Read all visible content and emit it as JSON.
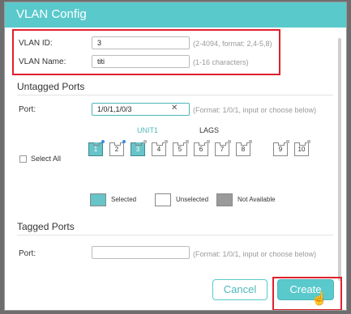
{
  "dialog": {
    "title": "VLAN Config"
  },
  "vlan_id": {
    "label": "VLAN ID:",
    "value": "3",
    "hint": "(2-4094, format: 2,4-5,8)"
  },
  "vlan_name": {
    "label": "VLAN Name:",
    "value": "titi",
    "hint": "(1-16 characters)"
  },
  "untagged": {
    "title": "Untagged Ports",
    "port_label": "Port:",
    "port_value": "1/0/1,1/0/3",
    "port_hint": "(Format: 1/0/1, input or choose below)",
    "unit_tab": "UNIT1",
    "lags_tab": "LAGS",
    "select_all": "Select All",
    "ports": [
      {
        "label": "1",
        "state": "selected"
      },
      {
        "label": "2",
        "state": "unselected"
      },
      {
        "label": "3",
        "state": "selected"
      },
      {
        "label": "4",
        "state": "unselected"
      },
      {
        "label": "5",
        "state": "unselected"
      },
      {
        "label": "6",
        "state": "unselected"
      },
      {
        "label": "7",
        "state": "unselected"
      },
      {
        "label": "8",
        "state": "unselected"
      }
    ],
    "lags": [
      {
        "label": "9",
        "state": "unselected"
      },
      {
        "label": "10",
        "state": "unselected"
      }
    ]
  },
  "legend": {
    "selected": "Selected",
    "unselected": "Unselected",
    "not_available": "Not Available"
  },
  "tagged": {
    "title": "Tagged Ports",
    "port_label": "Port:",
    "port_value": "",
    "port_hint": "(Format: 1/0/1, input or choose below)"
  },
  "buttons": {
    "cancel": "Cancel",
    "create": "Create"
  },
  "icons": {
    "clear": "close-icon",
    "cursor": "hand-pointer-icon"
  },
  "colors": {
    "accent": "#5ac9cc",
    "highlight": "#e0202d",
    "selected_port": "#67c4c8"
  }
}
